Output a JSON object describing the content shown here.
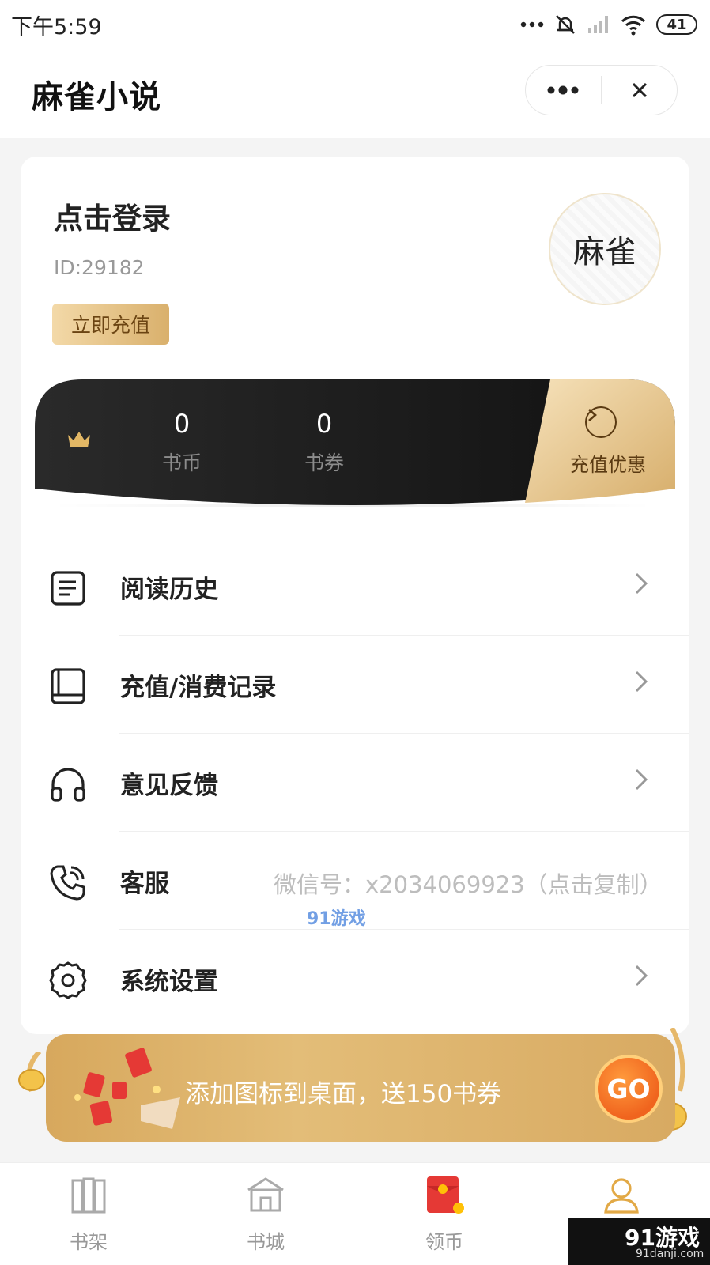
{
  "status_bar": {
    "time": "下午5:59",
    "battery": "41",
    "icons": [
      "dots-icon",
      "mute-bell-icon",
      "signal-icon",
      "wifi-icon",
      "battery-icon"
    ]
  },
  "nav": {
    "title": "麻雀小说",
    "more_icon": "more-dots-icon",
    "close_icon": "close-icon"
  },
  "profile": {
    "login_text": "点击登录",
    "id_text": "ID:29182",
    "recharge_button": "立即充值",
    "avatar_text": "麻雀"
  },
  "wallet": {
    "coins_value": "0",
    "coins_label": "书币",
    "vouchers_value": "0",
    "vouchers_label": "书券",
    "promo_label": "充值优惠"
  },
  "menu": {
    "items": [
      {
        "label": "阅读历史",
        "icon": "document-icon"
      },
      {
        "label": "充值/消费记录",
        "icon": "book-icon"
      },
      {
        "label": "意见反馈",
        "icon": "headphones-icon"
      },
      {
        "label": "客服",
        "icon": "phone-icon",
        "sub": "微信号：x2034069923（点击复制）"
      },
      {
        "label": "系统设置",
        "icon": "gear-icon"
      }
    ]
  },
  "add_icon_banner": {
    "text": "添加图标到桌面，送150书券",
    "go_label": "GO"
  },
  "tabs": [
    {
      "label": "书架",
      "icon": "bookshelf-icon"
    },
    {
      "label": "书城",
      "icon": "bookstore-icon"
    },
    {
      "label": "领币",
      "icon": "red-envelope-icon"
    },
    {
      "label": "",
      "icon": "user-icon"
    }
  ],
  "watermark": {
    "brand": "91游戏",
    "domain": "91danji.com"
  },
  "colors": {
    "gold": "#d9b06c",
    "dark_banner": "#1b1b1b",
    "accent_orange": "#f0641e",
    "tab_active": "#e2a946"
  }
}
